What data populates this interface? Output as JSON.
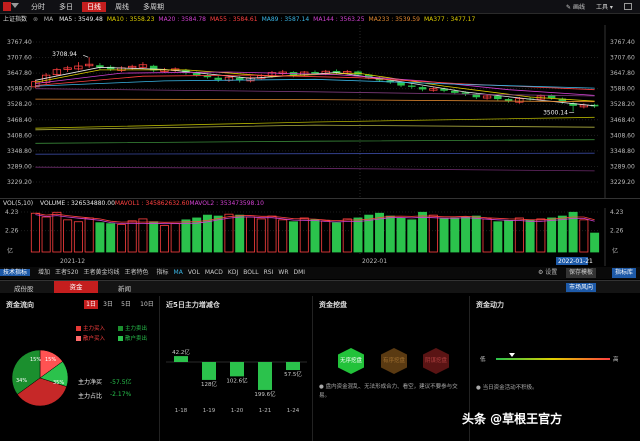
{
  "topbar": {
    "stock_name": "上证指数",
    "tabs": [
      "分时",
      "多日",
      "日线",
      "周线",
      "多周期"
    ],
    "active_tab": "日线",
    "right": [
      "画线",
      "工具",
      "窗口"
    ]
  },
  "indicators": {
    "name": "上证指数",
    "ma_label": "MA",
    "items": [
      {
        "text": "MA5 : 3549.48",
        "color": "#e8e8e8"
      },
      {
        "text": "MA10 : 3558.23",
        "color": "#e0d000"
      },
      {
        "text": "MA20 : 3584.78",
        "color": "#d040d0"
      },
      {
        "text": "MA55 : 3584.61",
        "color": "#ff4040"
      },
      {
        "text": "MA89 : 3587.14",
        "color": "#3ab6e6"
      },
      {
        "text": "MA144 : 3563.25",
        "color": "#d040d0"
      },
      {
        "text": "MA233 : 3539.59",
        "color": "#e08830"
      },
      {
        "text": "MA377 : 3477.17",
        "color": "#e0d000"
      }
    ]
  },
  "price_axis": [
    "3767.40",
    "3707.60",
    "3647.80",
    "3588.00",
    "3528.20",
    "3468.40",
    "3408.60",
    "3348.80",
    "3289.00",
    "3229.20"
  ],
  "annotations": {
    "high": "3708.94",
    "low": "3500.14"
  },
  "volume_header": {
    "label": "VOL(5,10)",
    "items": [
      {
        "text": "VOLUME : 326534880.00",
        "color": "#e8e8e8"
      },
      {
        "text": "MAVOL1 : 345862632.60",
        "color": "#ff4040"
      },
      {
        "text": "MAVOL2 : 353473598.10",
        "color": "#d040d0"
      }
    ]
  },
  "volume_axis": [
    "4.23",
    "2.26",
    "亿"
  ],
  "date_labels": [
    "2021-12",
    "2022-01",
    "2022-01-21"
  ],
  "toolbar": {
    "left": [
      "技术指标",
      "增加",
      "王者520",
      "王者黄金均线",
      "王者特色",
      "指标",
      "MA",
      "VOL",
      "MACD",
      "KDJ",
      "BOLL",
      "RSI",
      "WR",
      "DMI"
    ],
    "right": [
      "设置",
      "保存模板",
      "指标库"
    ]
  },
  "nav_tabs": [
    "成份股",
    "资金",
    "新闻"
  ],
  "nav_right": "市场风向",
  "panel1": {
    "title": "资金流向",
    "periods": [
      "1日",
      "3日",
      "5日",
      "10日"
    ],
    "legend": [
      {
        "label": "主力买入",
        "color": "#e53935"
      },
      {
        "label": "散户买入",
        "color": "#ff6b6b"
      },
      {
        "label": "主力卖出",
        "color": "#1b8f2e"
      },
      {
        "label": "散户卖出",
        "color": "#2bc24c"
      }
    ],
    "pie_pct": [
      "15%",
      "15%",
      "34%",
      "35%"
    ],
    "net_label": "主力净买",
    "net_value": "-57.5亿",
    "ratio_label": "主力占比",
    "ratio_value": "-2.17%"
  },
  "panel2": {
    "title": "近5日主力增减仓",
    "bars": [
      {
        "label": "42.2亿",
        "date": "1-18",
        "value": 42.2
      },
      {
        "label": "128亿",
        "date": "1-19",
        "value": -128
      },
      {
        "label": "102.6亿",
        "date": "1-20",
        "value": -102.6
      },
      {
        "label": "199.6亿",
        "date": "1-21",
        "value": -199.6
      },
      {
        "label": "57.5亿",
        "date": "1-24",
        "value": -57.5
      }
    ]
  },
  "panel3": {
    "title": "资金挖盘",
    "hex": [
      "无序挖盘",
      "有序挖盘",
      "阴谋挖盘"
    ],
    "note": "盘内资金混乱、无法形成合力、看空，建议不要参与交易。"
  },
  "panel4": {
    "title": "资金动力",
    "low": "低",
    "high": "高",
    "note": "当日资金活动不积极。"
  },
  "watermark": "头条 @草根王官方",
  "colors": {
    "up": "#ff4040",
    "down": "#2bc24c",
    "accent": "#c41e1e"
  }
}
